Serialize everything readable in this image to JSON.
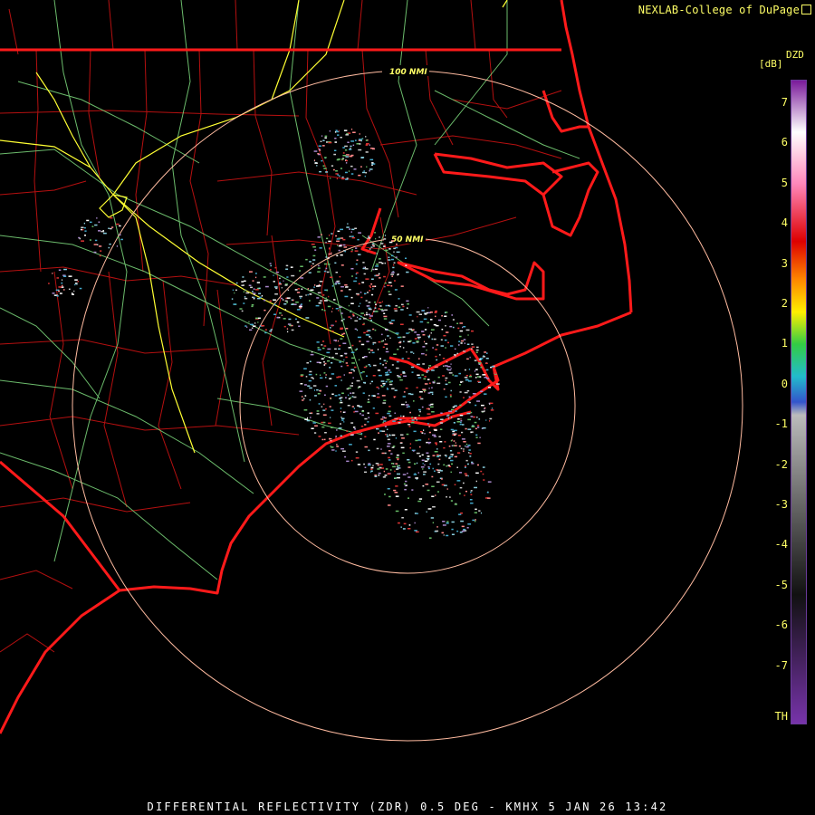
{
  "credit": {
    "text": "NEXLAB-College of DuPage"
  },
  "footer": {
    "product": "DIFFERENTIAL REFLECTIVITY (ZDR) 0.5 DEG - KMHX 5 JAN 26 13:42"
  },
  "rings": [
    {
      "label": "100 NMI"
    },
    {
      "label": "50 NMI"
    }
  ],
  "legend": {
    "title": "DZD",
    "unit": "[dB]",
    "ticks": [
      "7",
      "6",
      "5",
      "4",
      "3",
      "2",
      "1",
      "0",
      "-1",
      "-2",
      "-3",
      "-4",
      "-5",
      "-6",
      "-7",
      "TH"
    ],
    "colors": {
      "top": "#7a1a9a",
      "white": "#ffffff",
      "pink": "#ff88bb",
      "red": "#dd0000",
      "orange": "#ff8800",
      "yellow": "#ffee00",
      "green": "#33cc44",
      "cyan": "#22bbcc",
      "blue": "#3355cc",
      "gray": "#bbbbbb",
      "black": "#111111",
      "purple": "#7733aa"
    }
  },
  "map_colors": {
    "state_border": "#ff1a1a",
    "county_border": "#cc1111",
    "interstate": "#ffff33",
    "highway": "#88ee88",
    "range_ring": "#ffbba0"
  }
}
